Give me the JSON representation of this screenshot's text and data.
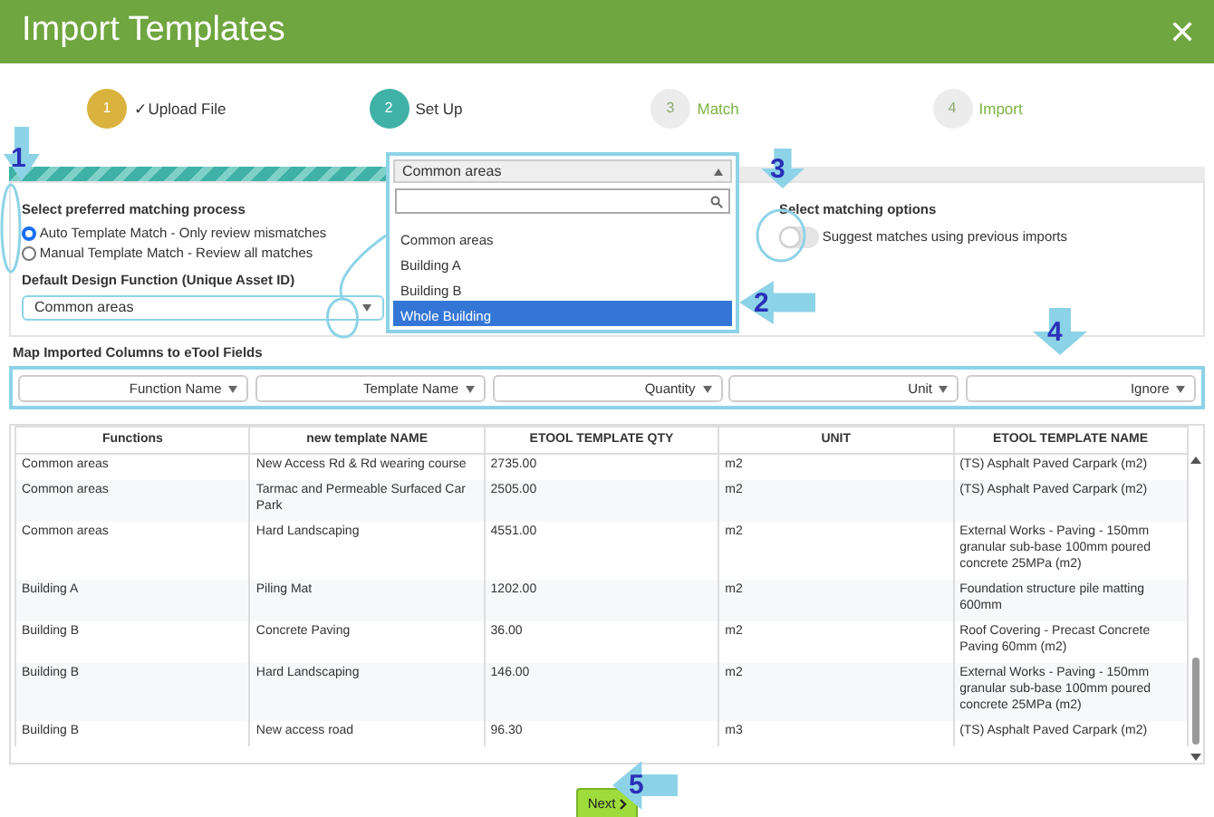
{
  "window": {
    "title": "Import Templates",
    "close": "✕"
  },
  "steps": [
    {
      "number": "1",
      "label": "Upload File",
      "check": "✓",
      "completed": true,
      "selected": false
    },
    {
      "number": "2",
      "label": "Set Up",
      "completed": false,
      "selected": true
    },
    {
      "number": "3",
      "label": "Match",
      "completed": false,
      "selected": false
    },
    {
      "number": "4",
      "label": "Import",
      "completed": false,
      "selected": false
    }
  ],
  "progress": {
    "level": 0.5
  },
  "matching_process": {
    "title": "Select preferred matching process",
    "options": [
      {
        "label": "Auto Template Match - Only review mismatches",
        "selected": true
      },
      {
        "label": "Manual Template Match - Review all matches",
        "selected": false
      }
    ]
  },
  "default_function": {
    "label": "Default Design Function (Unique Asset ID)",
    "value": "Common areas",
    "expanded": true
  },
  "dropdown": {
    "value": "Common areas",
    "options": [
      {
        "label": "Common areas",
        "highlighted": false
      },
      {
        "label": "Building A",
        "highlighted": false
      },
      {
        "label": "Building B",
        "highlighted": false
      },
      {
        "label": "Whole Building",
        "highlighted": true
      }
    ]
  },
  "matching_options": {
    "title": "Select matching options",
    "toggle": {
      "label": "Suggest matches using previous imports",
      "on": false
    }
  },
  "mapping": {
    "title": "Map Imported Columns to eTool Fields",
    "selects": [
      "Function Name",
      "Template Name",
      "Quantity",
      "Unit",
      "Ignore"
    ]
  },
  "table": {
    "columns": [
      "Functions",
      "new template NAME",
      "ETOOL TEMPLATE QTY",
      "UNIT",
      "ETOOL TEMPLATE NAME"
    ],
    "rows": [
      [
        "Common areas",
        "New Access Rd & Rd wearing course",
        "2735.00",
        "m2",
        "(TS) Asphalt Paved Carpark (m2)"
      ],
      [
        "Common areas",
        "Tarmac and Permeable Surfaced Car Park",
        "2505.00",
        "m2",
        "(TS) Asphalt Paved Carpark (m2)"
      ],
      [
        "Common areas",
        "Hard Landscaping",
        "4551.00",
        "m2",
        "External Works - Paving - 150mm granular sub-base 100mm poured concrete 25MPa (m2)"
      ],
      [
        "Building A",
        "Piling Mat",
        "1202.00",
        "m2",
        "Foundation structure pile matting 600mm"
      ],
      [
        "Building B",
        "Concrete Paving",
        "36.00",
        "m2",
        "Roof Covering - Precast Concrete Paving 60mm (m2)"
      ],
      [
        "Building B",
        "Hard Landscaping",
        "146.00",
        "m2",
        "External Works - Paving - 150mm granular sub-base 100mm poured concrete 25MPa (m2)"
      ],
      [
        "Building B",
        "New access road",
        "96.30",
        "m3",
        "(TS) Asphalt Paved Carpark (m2)"
      ]
    ]
  },
  "next_button": {
    "label": "Next"
  },
  "annotations": [
    {
      "number": "1"
    },
    {
      "number": "2"
    },
    {
      "number": "3"
    },
    {
      "number": "4"
    },
    {
      "number": "5"
    }
  ]
}
